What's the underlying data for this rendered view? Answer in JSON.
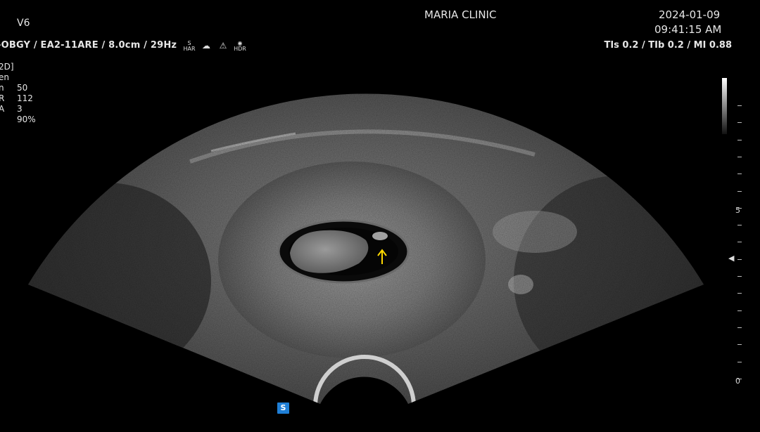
{
  "header": {
    "model": "V6",
    "clinic": "MARIA CLINIC",
    "date": "2024-01-09",
    "time": "09:41:15 AM"
  },
  "info_bar": {
    "preset": "-OBGY / EA2-11ARE / 8.0cm / 29Hz",
    "acoustic": "TIs  0.2 / TIb  0.2 / MI  0.88",
    "mode_icons": [
      {
        "name": "s-har-icon",
        "top": "S",
        "bottom": "HAR"
      },
      {
        "name": "cloud-icon",
        "top": "☁",
        "bottom": ""
      },
      {
        "name": "warning-triangle-icon",
        "top": "⚠",
        "bottom": ""
      },
      {
        "name": "eye-hdr-icon",
        "top": "◉",
        "bottom": "HDR"
      }
    ]
  },
  "imaging_params": [
    {
      "key": "2D]",
      "value": ""
    },
    {
      "key": "en",
      "value": ""
    },
    {
      "key": "n",
      "value": "50"
    },
    {
      "key": "R",
      "value": "112"
    },
    {
      "key": "A",
      "value": "3"
    },
    {
      "key": "",
      "value": "90%"
    }
  ],
  "depth_scale": {
    "labels": [
      "5",
      "0"
    ],
    "tick_count": 17
  },
  "probe_badge": "S",
  "annotation": {
    "arrow_color": "#ffd800"
  }
}
